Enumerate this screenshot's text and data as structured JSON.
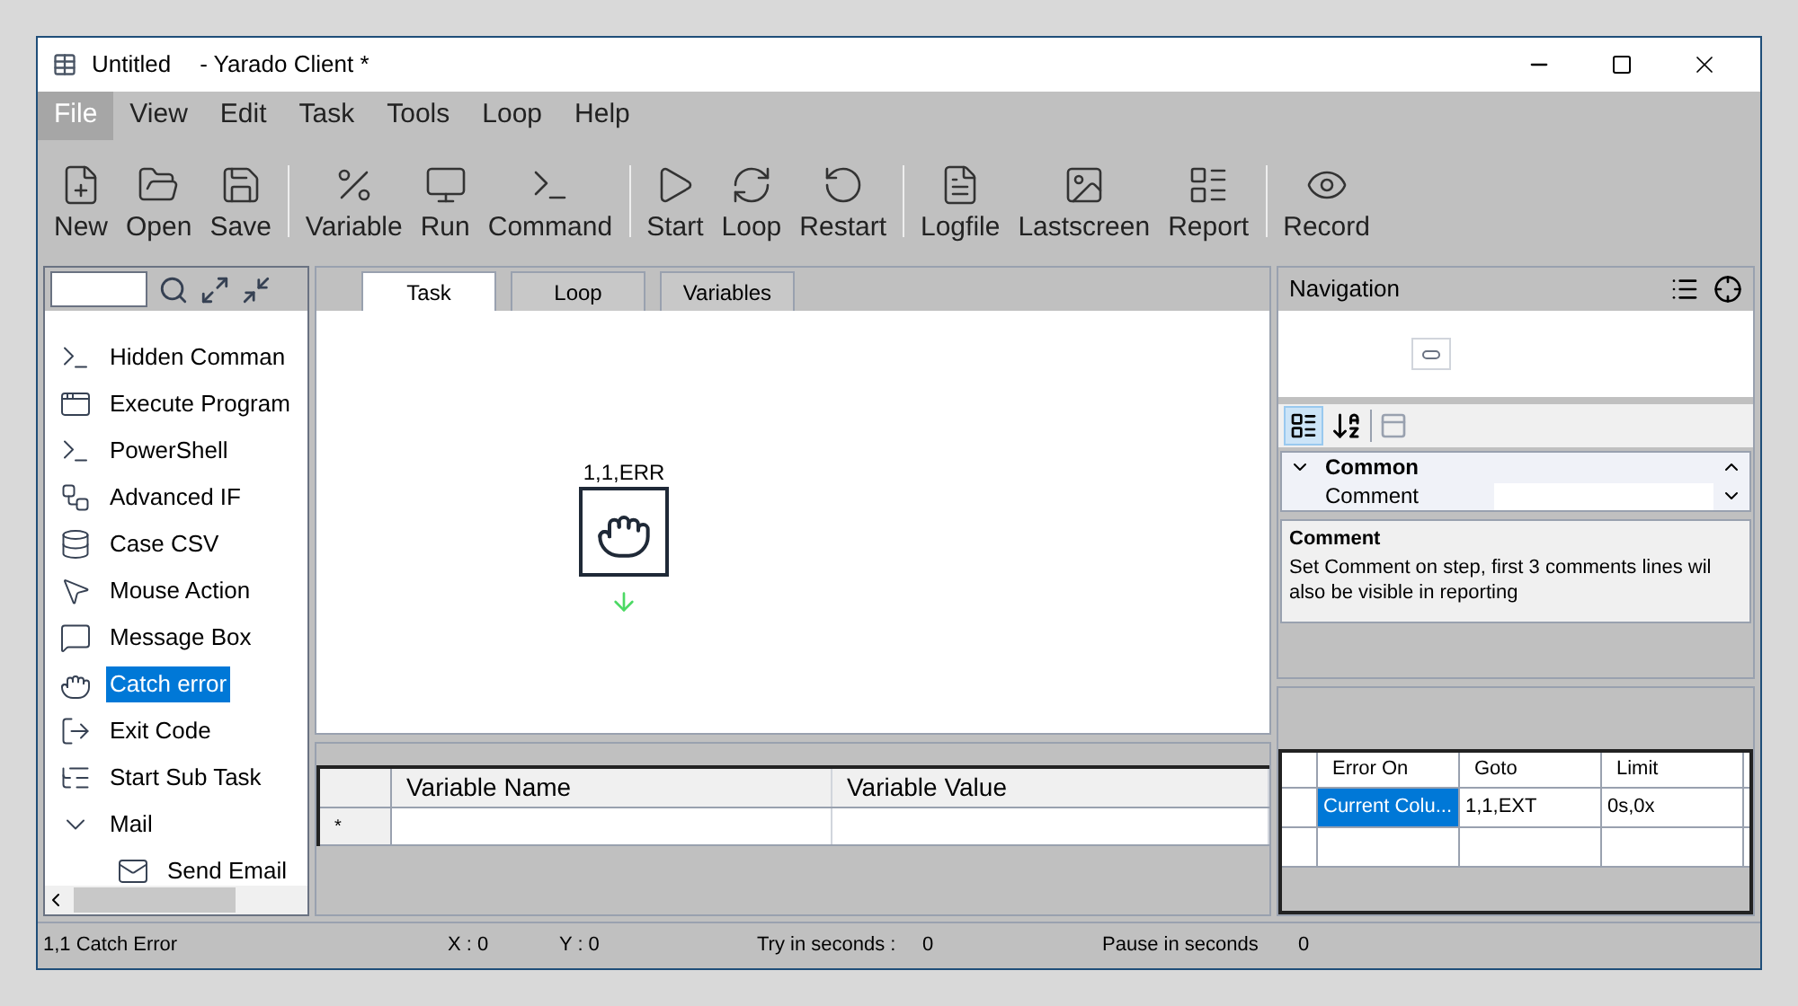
{
  "window": {
    "title": "Untitled",
    "app": "- Yarado Client *"
  },
  "menu": [
    {
      "label": "File",
      "selected": true
    },
    {
      "label": "View",
      "selected": false
    },
    {
      "label": "Edit",
      "selected": false
    },
    {
      "label": "Task",
      "selected": false
    },
    {
      "label": "Tools",
      "selected": false
    },
    {
      "label": "Loop",
      "selected": false
    },
    {
      "label": "Help",
      "selected": false
    }
  ],
  "toolbar": [
    [
      "New",
      "Open",
      "Save"
    ],
    [
      "Variable",
      "Run",
      "Command"
    ],
    [
      "Start",
      "Loop",
      "Restart"
    ],
    [
      "Logfile",
      "Lastscreen",
      "Report"
    ],
    [
      "Record"
    ]
  ],
  "sidebar": {
    "items": [
      {
        "label": "Hidden Comman",
        "selected": false
      },
      {
        "label": "Execute Program",
        "selected": false
      },
      {
        "label": "PowerShell",
        "selected": false
      },
      {
        "label": "Advanced IF",
        "selected": false
      },
      {
        "label": "Case CSV",
        "selected": false
      },
      {
        "label": "Mouse Action",
        "selected": false
      },
      {
        "label": "Message Box",
        "selected": false
      },
      {
        "label": "Catch error",
        "selected": true
      },
      {
        "label": "Exit Code",
        "selected": false
      },
      {
        "label": "Start Sub Task",
        "selected": false
      },
      {
        "label": "Mail",
        "selected": false,
        "expanded": true,
        "children": [
          {
            "label": "Send Email",
            "selected": false
          }
        ]
      }
    ]
  },
  "tabs": [
    {
      "label": "Task",
      "selected": true
    },
    {
      "label": "Loop",
      "selected": false
    },
    {
      "label": "Variables",
      "selected": false
    }
  ],
  "canvas": {
    "node": {
      "label": "1,1,ERR"
    }
  },
  "variables_table": {
    "columns": [
      "Variable Name",
      "Variable Value"
    ],
    "rows": [
      {
        "marker": "*",
        "cells": [
          "",
          ""
        ]
      }
    ]
  },
  "navigation": {
    "title": "Navigation"
  },
  "properties": {
    "category": "Common",
    "expanded": true,
    "rows": [
      {
        "name": "Comment"
      }
    ],
    "description_title": "Comment",
    "description": "Set Comment on step, first 3 comments lines wil also be visible in reporting"
  },
  "error_table": {
    "columns": [
      "Error On",
      "Goto",
      "Limit"
    ],
    "rows": [
      {
        "cells": [
          {
            "text": "Current Colu...",
            "selected": true
          },
          {
            "text": "1,1,EXT",
            "selected": false
          },
          {
            "text": "0s,0x",
            "selected": false
          }
        ]
      }
    ]
  },
  "status_bar": [
    {
      "label": "1,1 Catch Error"
    },
    {
      "label": "X :  0"
    },
    {
      "label": "Y :  0"
    },
    {
      "label": "Try in seconds :"
    },
    {
      "label": "0"
    },
    {
      "label": "Pause in seconds"
    },
    {
      "label": "0"
    }
  ]
}
